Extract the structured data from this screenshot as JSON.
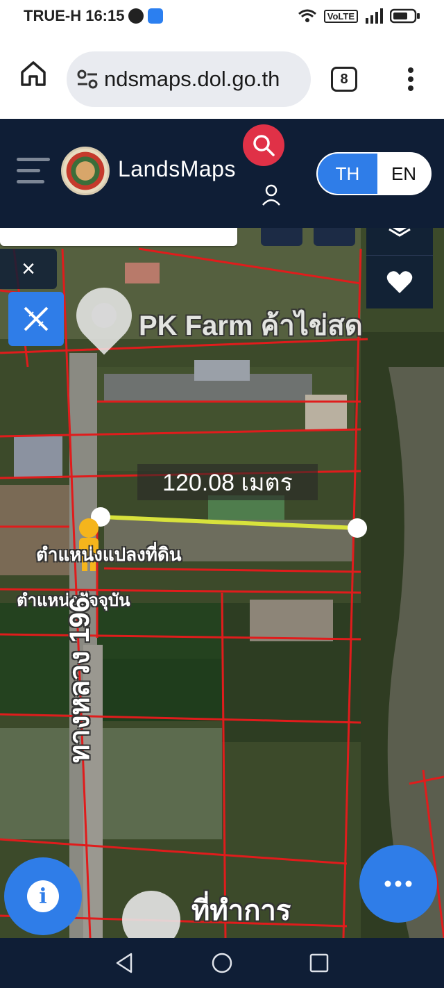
{
  "status_bar": {
    "carrier_time": "TRUE-H 16:15",
    "volte": "VoLTE"
  },
  "browser": {
    "url": "ndsmaps.dol.go.th",
    "tab_count": "8"
  },
  "header": {
    "brand": "LandsMaps",
    "lang_th": "TH",
    "lang_en": "EN"
  },
  "map": {
    "poi_label": "PK Farm ค้าไข่สด",
    "distance": "120.08 เมตร",
    "parcel_position_label": "ตำแหน่งแปลงที่ดิน",
    "current_position_label": "ตำแหน่งปัจจุบัน",
    "road_label": "ทางหลวง 196",
    "office_label": "ที่ทำการ",
    "close_symbol": "×"
  },
  "colors": {
    "header_bg": "#0f1e36",
    "accent_blue": "#2f7de8",
    "search_red": "#e03147",
    "parcel_line": "#e01c1c",
    "measure_line": "#d8e23c"
  },
  "icons": [
    "home-icon",
    "tune-icon",
    "more-vert-icon",
    "hamburger-icon",
    "search-icon",
    "user-icon",
    "layers-icon",
    "heart-icon",
    "close-icon",
    "measure-icon",
    "info-icon",
    "more-horiz-icon",
    "back-icon",
    "home-circle-icon",
    "recents-icon"
  ]
}
